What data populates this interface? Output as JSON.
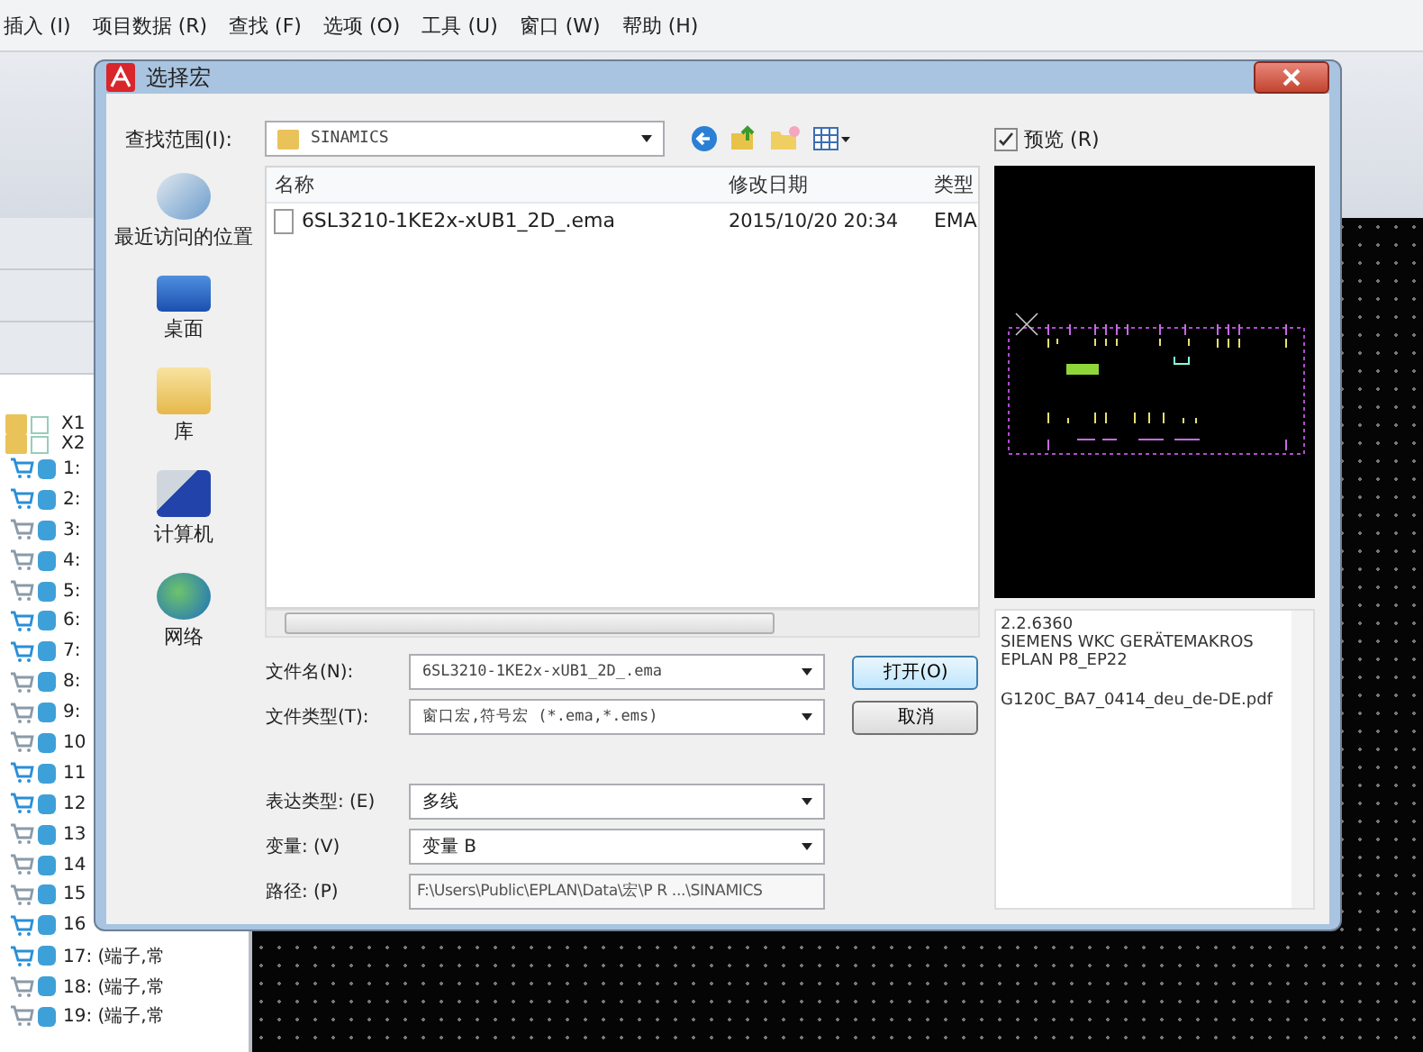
{
  "menu_bar": {
    "items": [
      "插入 (I)",
      "项目数据 (R)",
      "查找 (F)",
      "选项 (O)",
      "工具 (U)",
      "窗口 (W)",
      "帮助 (H)"
    ]
  },
  "tree": {
    "items": [
      {
        "label": "X1",
        "kind": "folder"
      },
      {
        "label": "X2",
        "kind": "folder"
      },
      {
        "label": "1:",
        "kind": "part",
        "placed": true
      },
      {
        "label": "2:",
        "kind": "part",
        "placed": true
      },
      {
        "label": "3:",
        "kind": "part",
        "placed": false
      },
      {
        "label": "4:",
        "kind": "part",
        "placed": false
      },
      {
        "label": "5:",
        "kind": "part",
        "placed": false
      },
      {
        "label": "6:",
        "kind": "part",
        "placed": true
      },
      {
        "label": "7:",
        "kind": "part",
        "placed": true
      },
      {
        "label": "8:",
        "kind": "part",
        "placed": false
      },
      {
        "label": "9:",
        "kind": "part",
        "placed": false
      },
      {
        "label": "10",
        "kind": "part",
        "placed": false
      },
      {
        "label": "11",
        "kind": "part",
        "placed": true
      },
      {
        "label": "12",
        "kind": "part",
        "placed": true
      },
      {
        "label": "13",
        "kind": "part",
        "placed": false
      },
      {
        "label": "14",
        "kind": "part",
        "placed": false
      },
      {
        "label": "15",
        "kind": "part",
        "placed": false
      },
      {
        "label": "16",
        "kind": "part",
        "placed": true
      },
      {
        "label": "17: (端子,常",
        "kind": "part",
        "placed": true
      },
      {
        "label": "18: (端子,常",
        "kind": "part",
        "placed": false
      },
      {
        "label": "19: (端子,常",
        "kind": "part",
        "placed": false
      }
    ]
  },
  "dialog": {
    "title": "选择宏",
    "look_in": {
      "label": "查找范围(I):",
      "value": "SINAMICS"
    },
    "places": [
      "最近访问的位置",
      "桌面",
      "库",
      "计算机",
      "网络"
    ],
    "file_list": {
      "columns": [
        "名称",
        "修改日期",
        "类型"
      ],
      "rows": [
        {
          "name": "6SL3210-1KE2x-xUB1_2D_.ema",
          "modified": "2015/10/20 20:34",
          "type": "EMA"
        }
      ]
    },
    "preview_checkbox": {
      "label": "预览 (R)",
      "checked": true
    },
    "info": {
      "blocks": [
        [
          "2.2.6360",
          "SIEMENS WKC GERÄTEMAKROS",
          "EPLAN P8_EP22"
        ],
        [
          "G120C_BA7_0414_deu_de-DE.pdf"
        ]
      ]
    },
    "fields": [
      {
        "label": "文件名(N):",
        "value": "6SL3210-1KE2x-xUB1_2D_.ema",
        "kind": "combo"
      },
      {
        "label": "文件类型(T):",
        "value": "窗口宏,符号宏 (*.ema,*.ems)",
        "kind": "dropdown"
      },
      {
        "label": "表达类型: (E)",
        "value": "多线",
        "kind": "dropdown"
      },
      {
        "label": "变量: (V)",
        "value": "变量 B",
        "kind": "dropdown"
      },
      {
        "label": "路径: (P)",
        "value": "F:\\Users\\Public\\EPLAN\\Data\\宏\\P R ...\\SINAMICS",
        "kind": "readonly"
      }
    ],
    "buttons": [
      "打开(O)",
      "取消"
    ]
  }
}
